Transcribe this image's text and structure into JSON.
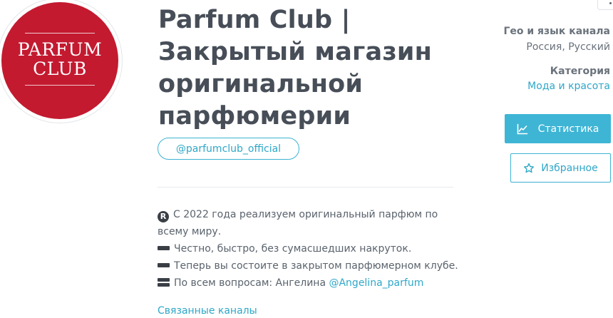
{
  "channel": {
    "avatar_logo_lines": [
      "PARFUM",
      "CLUB"
    ],
    "title": "Parfum Club | Закрытый магазин оригинальной парфюмерии",
    "handle": "@parfumclub_official"
  },
  "description": {
    "line1": "С 2022 года реализуем оригинальный парфюм по всему миру.",
    "line2": "Честно, быстро, без сумасшедших накруток.",
    "line3": "Теперь вы состоите в закрытом парфюмерном клубе.",
    "line4_prefix": "По всем вопросам: Ангелина ",
    "line4_link": "@Angelina_parfum",
    "emoji_line1": "registered-icon",
    "emoji_dash": "heavy-minus-icon",
    "emoji_double_dash": "double-bar-icon"
  },
  "related_channels": "Связанные каналы",
  "sidebar": {
    "geo_label": "Гео и язык канала",
    "geo_value": "Россия, Русский",
    "category_label": "Категория",
    "category_value": "Мода и красота",
    "stats_button": "Статистика",
    "favorites_button": "Избранное",
    "stats_icon": "line-chart-icon",
    "favorites_icon": "star-outline-icon"
  },
  "colors": {
    "accent": "#3fb5d5",
    "link": "#2ea7c8",
    "avatar_bg": "#c31a30",
    "title": "#474e58"
  }
}
